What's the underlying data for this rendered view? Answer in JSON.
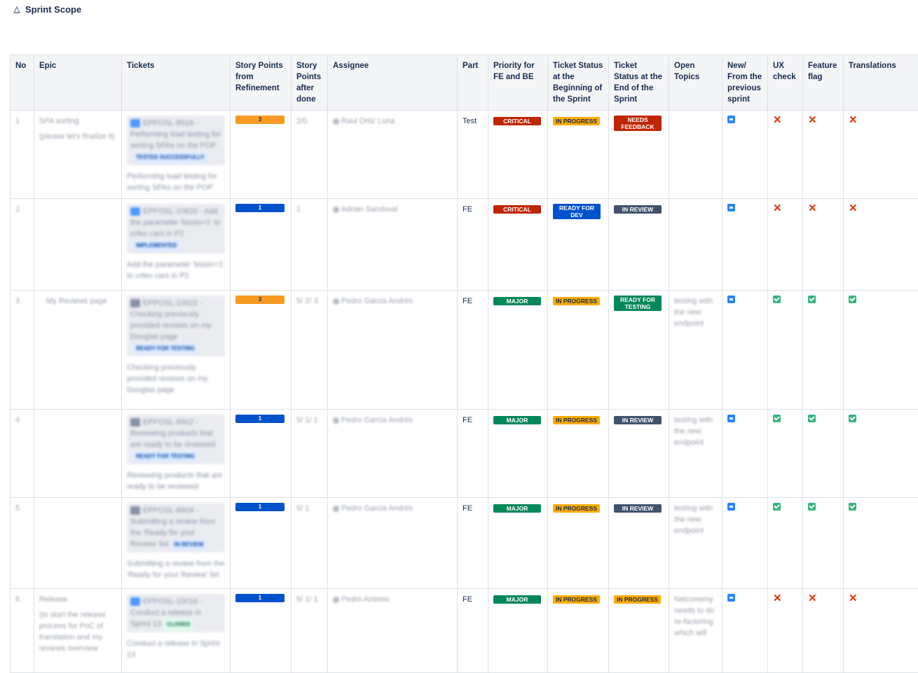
{
  "page": {
    "title": "Sprint Scope",
    "icon": "document-icon"
  },
  "columns": [
    "No",
    "Epic",
    "Tickets",
    "Story Points from Refinement",
    "Story Points after done",
    "Assignee",
    "Part",
    "Priority for FE and BE",
    "Ticket Status at the Beginning of the Sprint",
    "Ticket Status at the End of the Sprint",
    "Open Topics",
    "New/ From the previous sprint",
    "UX check",
    "Feature flag",
    "Translations"
  ],
  "rows": [
    {
      "no": "1",
      "epic": "SPA sorting",
      "epic_note": "(please let's finalize it)",
      "ticket_key": "EPPOSL-8518",
      "ticket_title": "Performing load testing for sorting SPAs on the POP",
      "ticket_status": "TESTED SUCCESSFULLY",
      "ticket_summary": "Performing load testing for sorting SPAs on the POP",
      "sp_ref": "3",
      "sp_after": "2/0",
      "assignee": "Raul Ortiz Luna",
      "part": "Test",
      "priority": "CRITICAL",
      "status_begin": "IN PROGRESS",
      "status_end": "NEEDS FEEDBACK",
      "open_topics": "",
      "new": "checked",
      "ux": "✕",
      "flag": "✕",
      "translations": "✕"
    },
    {
      "no": "2",
      "epic": "",
      "epic_note": "",
      "ticket_key": "EPPOSL-10820",
      "ticket_title": "Add the parameter 'bissin=1' to crfeo cars in P2",
      "ticket_status": "IMPLEMENTED",
      "ticket_summary": "Add the parameter 'bissin=1' to crfeo cars in P2",
      "sp_ref": "1",
      "sp_after": "1",
      "assignee": "Adrian Sandoval",
      "part": "FE",
      "priority": "CRITICAL",
      "status_begin": "READY FOR DEV",
      "status_end": "IN REVIEW",
      "open_topics": "",
      "new": "checked",
      "ux": "✕",
      "flag": "✕",
      "translations": "✕"
    },
    {
      "no": "3",
      "epic": "My Reviews page",
      "epic_note": "",
      "ticket_key": "EPPOSL-10022",
      "ticket_title": "Checking previously provided reviews on my Douglas page",
      "ticket_status": "READY FOR TESTING",
      "ticket_summary": "Checking previously provided reviews on my Douglas page",
      "sp_ref": "3",
      "sp_after": "5/ 2/ 3",
      "assignee": "Pedro Garcia Andrés",
      "part": "FE",
      "priority": "MAJOR",
      "status_begin": "IN PROGRESS",
      "status_end": "READY FOR TESTING",
      "open_topics": "testing with the new endpoint",
      "new": "checked",
      "ux": "ok",
      "flag": "ok",
      "translations": "ok"
    },
    {
      "no": "4",
      "epic": "",
      "epic_note": "",
      "ticket_key": "EPPOSL-8902",
      "ticket_title": "Reviewing products that are ready to be reviewed",
      "ticket_status": "READY FOR TESTING",
      "ticket_summary": "Reviewing products that are ready to be reviewed",
      "sp_ref": "1",
      "sp_after": "5/ 1/ 1",
      "assignee": "Pedro Garcia Andrés",
      "part": "FE",
      "priority": "MAJOR",
      "status_begin": "IN PROGRESS",
      "status_end": "IN REVIEW",
      "open_topics": "testing with the new endpoint",
      "new": "checked",
      "ux": "ok",
      "flag": "ok",
      "translations": "ok"
    },
    {
      "no": "5",
      "epic": "",
      "epic_note": "",
      "ticket_key": "EPPOSL-8904",
      "ticket_title": "Submitting a review from the 'Ready for your Review' list",
      "ticket_status": "IN REVIEW",
      "ticket_summary": "Submitting a review from the 'Ready for your Review' list",
      "sp_ref": "1",
      "sp_after": "5/ 1",
      "assignee": "Pedro Garcia Andrés",
      "part": "FE",
      "priority": "MAJOR",
      "status_begin": "IN PROGRESS",
      "status_end": "IN REVIEW",
      "open_topics": "testing with the new endpoint",
      "new": "checked",
      "ux": "ok",
      "flag": "ok",
      "translations": "ok"
    },
    {
      "no": "6",
      "epic": "Release",
      "epic_note": "(to start the release process for PoC of translation and my reviews overview",
      "ticket_key": "EPPOSL-10016",
      "ticket_title": "Conduct a release in Sprint 13",
      "ticket_status": "CLOSED",
      "ticket_summary": "Conduct a release in Sprint 13",
      "sp_ref": "1",
      "sp_after": "5/ 1/ 1",
      "assignee": "Pedro Antonio",
      "part": "FE",
      "priority": "MAJOR",
      "status_begin": "IN PROGRESS",
      "status_end": "IN PROGRESS",
      "open_topics": "Netconomy needs to do re-factoring which will",
      "new": "checked",
      "ux": "✕",
      "flag": "✕",
      "translations": "✕"
    }
  ]
}
